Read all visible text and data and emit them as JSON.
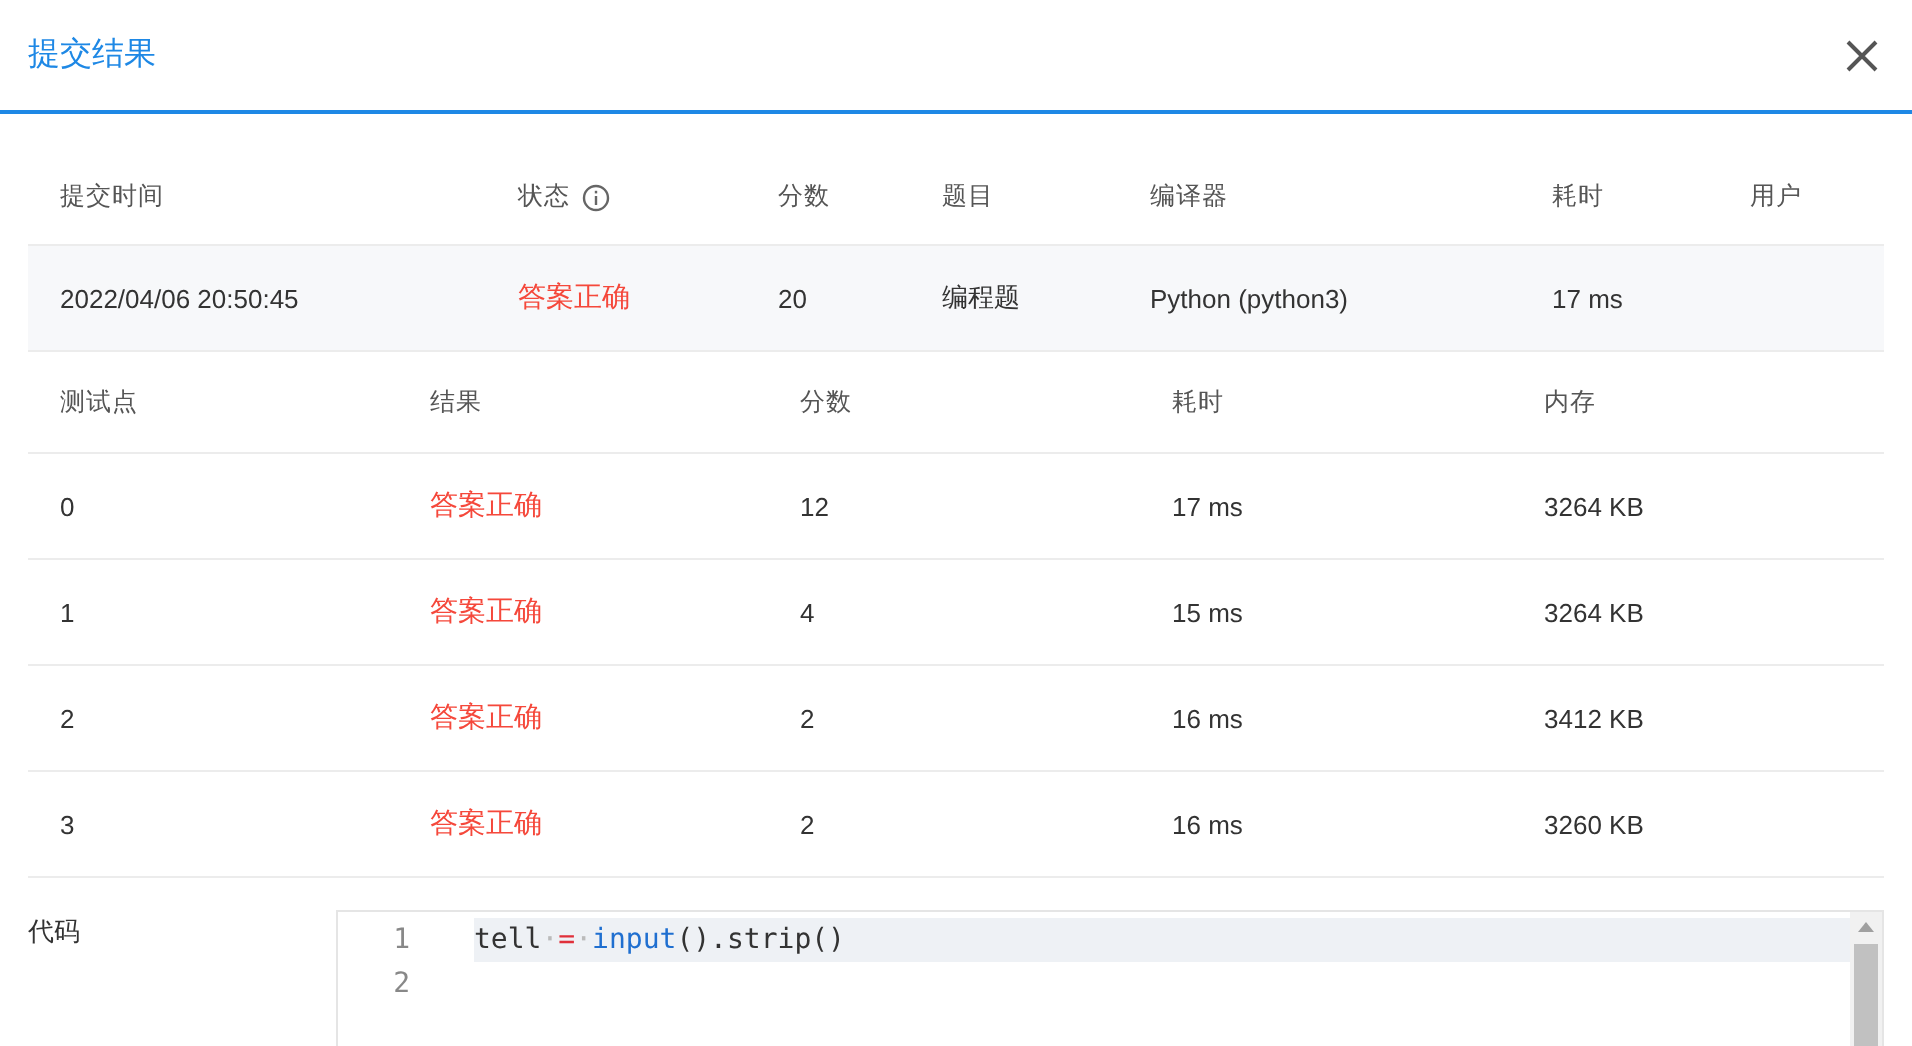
{
  "dialog": {
    "title": "提交结果"
  },
  "submission": {
    "columns": [
      {
        "label": "提交时间"
      },
      {
        "label": "状态",
        "info": true
      },
      {
        "label": "分数"
      },
      {
        "label": "题目"
      },
      {
        "label": "编译器"
      },
      {
        "label": "耗时"
      },
      {
        "label": "用户"
      }
    ],
    "row": [
      {
        "text": "2022/04/06 20:50:45"
      },
      {
        "text": "答案正确"
      },
      {
        "text": "20"
      },
      {
        "text": "编程题"
      },
      {
        "text": "Python (python3)"
      },
      {
        "text": "17 ms"
      }
    ]
  },
  "test_points": {
    "columns": [
      "测试点",
      "结果",
      "分数",
      "耗时",
      "内存"
    ],
    "rows": [
      {
        "cells": [
          "0",
          "答案正确",
          "12",
          "17 ms",
          "3264 KB"
        ]
      },
      {
        "cells": [
          "1",
          "答案正确",
          "4",
          "15 ms",
          "3264 KB"
        ]
      },
      {
        "cells": [
          "2",
          "答案正确",
          "2",
          "16 ms",
          "3412 KB"
        ]
      },
      {
        "cells": [
          "3",
          "答案正确",
          "2",
          "16 ms",
          "3260 KB"
        ]
      }
    ]
  },
  "code": {
    "label": "代码",
    "lines": [
      {
        "number": "1",
        "highlighted": true,
        "tokens": [
          {
            "text": "tell",
            "kind": "plain"
          },
          {
            "text": "·",
            "kind": "space"
          },
          {
            "text": "=",
            "kind": "operator"
          },
          {
            "text": "·",
            "kind": "space"
          },
          {
            "text": "input",
            "kind": "builtin"
          },
          {
            "text": "().strip()",
            "kind": "plain"
          }
        ]
      },
      {
        "number": "2",
        "highlighted": false
      }
    ]
  }
}
